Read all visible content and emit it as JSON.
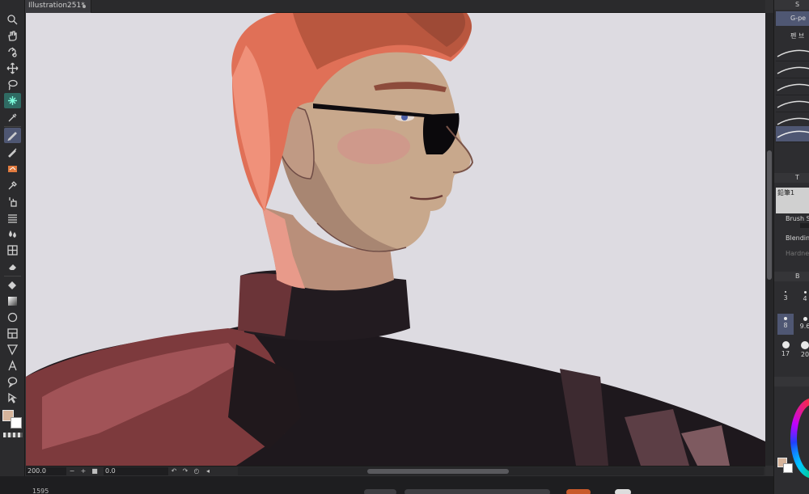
{
  "document": {
    "tab_title": "Illustration251*"
  },
  "toolbar": {
    "tools": [
      {
        "name": "zoom-tool-icon",
        "icon": "magnifier"
      },
      {
        "name": "hand-tool-icon",
        "icon": "hand"
      },
      {
        "name": "rotate-tool-icon",
        "icon": "rotate"
      },
      {
        "name": "move-tool-icon",
        "icon": "move-arrows"
      },
      {
        "name": "lasso-tool-icon",
        "icon": "lasso"
      },
      {
        "name": "auto-select-tool-icon",
        "icon": "magic-wand"
      },
      {
        "name": "eyedropper-tool-icon",
        "icon": "eyedropper"
      },
      {
        "name": "pen-tool-icon",
        "icon": "pen"
      },
      {
        "name": "pencil-tool-icon",
        "icon": "pencil"
      },
      {
        "name": "brush-tool-icon",
        "icon": "brush"
      },
      {
        "name": "marker-tool-icon",
        "icon": "marker"
      },
      {
        "name": "airbrush-tool-icon",
        "icon": "airbrush"
      },
      {
        "name": "decoration-tool-icon",
        "icon": "lines"
      },
      {
        "name": "blend-tool-icon",
        "icon": "drops"
      },
      {
        "name": "liquify-tool-icon",
        "icon": "grid"
      },
      {
        "name": "eraser-tool-icon",
        "icon": "eraser"
      },
      {
        "name": "fill-tool-icon",
        "icon": "bucket"
      },
      {
        "name": "gradient-tool-icon",
        "icon": "gradient"
      },
      {
        "name": "figure-tool-icon",
        "icon": "circle"
      },
      {
        "name": "frame-tool-icon",
        "icon": "frame"
      },
      {
        "name": "ruler-tool-icon",
        "icon": "ruler"
      },
      {
        "name": "text-tool-icon",
        "icon": "text-A"
      },
      {
        "name": "balloon-tool-icon",
        "icon": "speech-bubble"
      },
      {
        "name": "correct-line-tool-icon",
        "icon": "cursor"
      }
    ],
    "main_color": "#d6b49b",
    "sub_color": "#ffffff"
  },
  "statusbar": {
    "zoom": "200.0",
    "angle": "0.0"
  },
  "bottom": {
    "coord": "1595"
  },
  "right_panel": {
    "sub_tool_header": "S",
    "sub_tools": [
      "G-pe",
      "펜 브"
    ],
    "tool_property_header": "T",
    "tool_name": "鉛筆1",
    "brush_size_label": "Brush S",
    "blending_label": "Blendin",
    "hardness_label": "Hardne",
    "brush_size_header": "B",
    "brush_sizes": [
      "3",
      "4",
      "8",
      "9.6",
      "17",
      "20"
    ]
  },
  "colors": {
    "canvas_bg": "#dddbe1",
    "accent_selected": "#4f5773",
    "hair": "#d4664f",
    "skin": "#c5a489",
    "sweater": "#1c171c"
  }
}
